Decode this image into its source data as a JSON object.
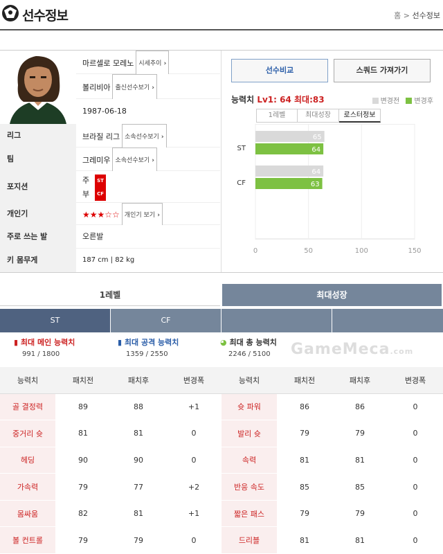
{
  "header": {
    "title": "선수정보",
    "breadcrumb": {
      "home": "홈",
      "sep": ">",
      "current": "선수정보"
    }
  },
  "player": {
    "name": "마르셀로 모레노",
    "name_btn": "시세추이",
    "nation": "볼리비아",
    "nation_btn": "출신선수보기",
    "birth": "1987-06-18",
    "league_label": "리그",
    "league": "브라질 리그",
    "league_btn": "소속선수보기",
    "team_label": "팀",
    "team": "그레미우",
    "team_btn": "소속선수보기",
    "position_label": "포지션",
    "pos_main_label": "주",
    "pos_main": "ST",
    "pos_sub_label": "부",
    "pos_sub": "CF",
    "popularity_label": "개인기",
    "stars_filled": 3,
    "stars_total": 5,
    "stars": "★★★☆☆",
    "popularity_btn": "개인기 보기",
    "foot_label": "주로 쓰는 발",
    "foot": "오른발",
    "body_label": "키 몸무게",
    "body": "187 cm | 82 kg"
  },
  "actions": {
    "compare": "선수비교",
    "squad": "스쿼드 가져가기"
  },
  "ability": {
    "label": "능력치",
    "level": "Lv1: 64",
    "max": "최대:83",
    "legend_before": "변경전",
    "legend_after": "변경후",
    "color_before": "#d9d9d9",
    "color_after": "#7dc142"
  },
  "chart_tabs": [
    "1레벨",
    "최대성장",
    "로스터정보"
  ],
  "chart_data": {
    "type": "bar",
    "categories": [
      "ST",
      "CF"
    ],
    "series": [
      {
        "name": "변경전",
        "values": [
          65,
          64
        ]
      },
      {
        "name": "변경후",
        "values": [
          64,
          63
        ]
      }
    ],
    "xlim": [
      0,
      150
    ],
    "xticks": [
      0,
      50,
      100,
      150
    ]
  },
  "level_tabs": {
    "left": "1레벨",
    "right": "최대성장"
  },
  "positions": [
    "ST",
    "CF",
    "",
    ""
  ],
  "stats": [
    {
      "title": "최대 메인 능력치",
      "value": "991 / 1800"
    },
    {
      "title": "최대 공격 능력치",
      "value": "1359 / 2550"
    },
    {
      "title": "최대 총 능력치",
      "value": "2246 / 5100"
    }
  ],
  "watermark": "GameMeca",
  "watermark_suffix": ".com",
  "table": {
    "headers": [
      "능력치",
      "패치전",
      "패치후",
      "변경폭",
      "능력치",
      "패치전",
      "패치후",
      "변경폭"
    ],
    "rows": [
      [
        "골 결정력",
        "89",
        "88",
        "+1",
        "슛 파워",
        "86",
        "86",
        "0"
      ],
      [
        "중거리 슛",
        "81",
        "81",
        "0",
        "발리 슛",
        "79",
        "79",
        "0"
      ],
      [
        "헤딩",
        "90",
        "90",
        "0",
        "속력",
        "81",
        "81",
        "0"
      ],
      [
        "가속력",
        "79",
        "77",
        "+2",
        "반응 속도",
        "85",
        "85",
        "0"
      ],
      [
        "몸싸움",
        "82",
        "81",
        "+1",
        "짧은 패스",
        "79",
        "79",
        "0"
      ],
      [
        "볼 컨트롤",
        "79",
        "79",
        "0",
        "드리블",
        "81",
        "81",
        "0"
      ]
    ]
  }
}
